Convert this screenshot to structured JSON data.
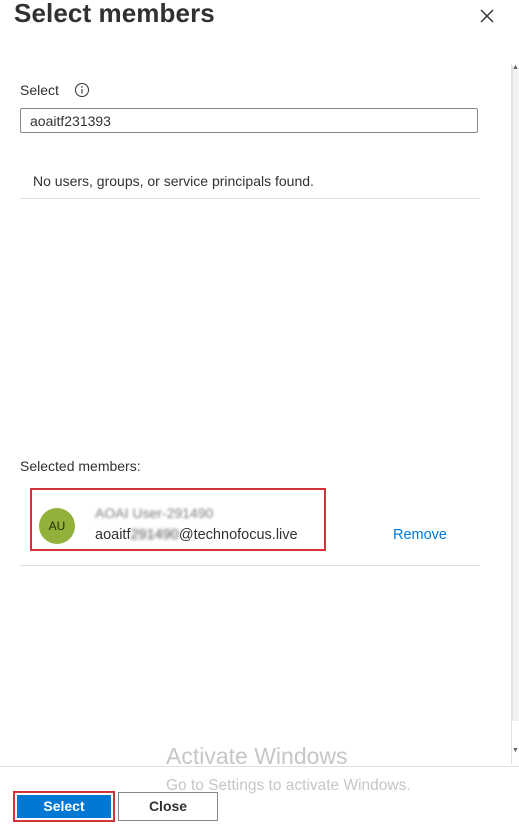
{
  "panel": {
    "title": "Select members",
    "close_icon": "close-icon"
  },
  "search": {
    "label": "Select",
    "info_icon": "info-icon",
    "value": "aoaitf231393",
    "placeholder": ""
  },
  "results": {
    "empty_message": "No users, groups, or service principals found."
  },
  "selected": {
    "label": "Selected members:",
    "members": [
      {
        "initials": "AU",
        "name": "AOAI User-291490",
        "email_prefix": "aoaitf",
        "email_redacted": "291490",
        "email_domain": "@technofocus.live",
        "remove_label": "Remove",
        "avatar_color": "#92b13a"
      }
    ]
  },
  "watermark": {
    "title": "Activate Windows",
    "subtitle": "Go to Settings to activate Windows."
  },
  "footer": {
    "select_label": "Select",
    "close_label": "Close"
  },
  "colors": {
    "accent": "#0078d4",
    "highlight_border": "#d13438",
    "text": "#323130"
  }
}
